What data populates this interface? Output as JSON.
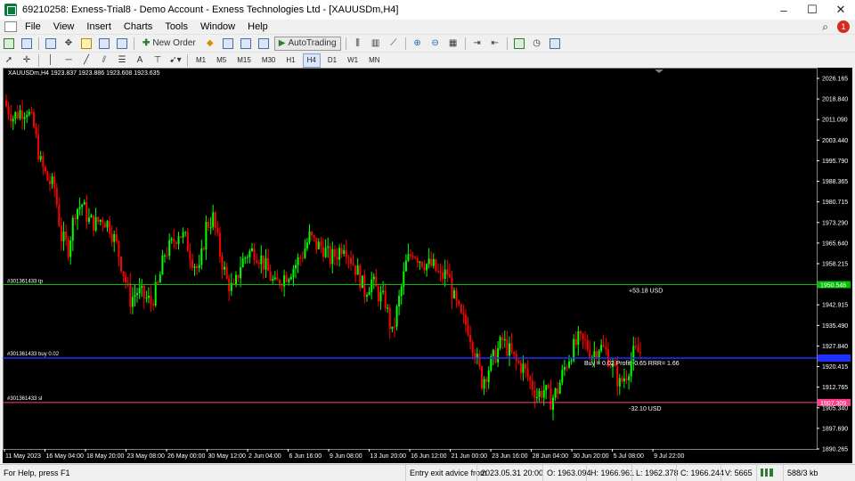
{
  "window": {
    "title": "69210258: Exness-Trial8 - Demo Account - Exness Technologies Ltd - [XAUUSDm,H4]",
    "controls": [
      "–",
      "☐",
      "✕"
    ]
  },
  "menu": {
    "items": [
      "File",
      "View",
      "Insert",
      "Charts",
      "Tools",
      "Window",
      "Help"
    ],
    "notification_count": "1"
  },
  "toolbar": {
    "new_order_label": "New Order",
    "autotrading_label": "AutoTrading",
    "timeframes": [
      "M1",
      "M5",
      "M15",
      "M30",
      "H1",
      "H4",
      "D1",
      "W1",
      "MN"
    ],
    "active_timeframe": "H4",
    "text_tool": "A"
  },
  "chart": {
    "header": "XAUUSDm,H4  1923.837 1923.886 1923.608 1923.635",
    "colors": {
      "bull": "#00ff00",
      "bear": "#ff0000",
      "tp": "#00c000",
      "entry": "#2030ff",
      "sl": "#ff3d8a",
      "info": "#ffd500"
    },
    "objects": {
      "tp_label": "#301361433 tp",
      "buy_label": "#301361433 buy 0.02",
      "sl_label": "#301361433 sl",
      "tp_profit": "+53.18 USD",
      "sl_loss": "-32.10 USD",
      "trade_info": "Buy = 0.02 Profit -0.65   RRR= 1.66",
      "tp_price": "1950.546",
      "sl_price": "1907.309"
    },
    "y_ticks": [
      "2026.165",
      "2018.840",
      "2011.090",
      "2003.440",
      "1995.790",
      "1988.365",
      "1980.715",
      "1973.290",
      "1965.640",
      "1958.215",
      "1950.565",
      "1942.915",
      "1935.490",
      "1927.840",
      "1920.415",
      "1912.765",
      "1905.340",
      "1897.690",
      "1890.265"
    ],
    "x_ticks": [
      "11 May 2023",
      "16 May 04:00",
      "18 May 20:00",
      "23 May 08:00",
      "26 May 00:00",
      "30 May 12:00",
      "2 Jun 04:00",
      "6 Jun 16:00",
      "9 Jun 08:00",
      "13 Jun 20:00",
      "16 Jun 12:00",
      "21 Jun 00:00",
      "23 Jun 16:00",
      "28 Jun 04:00",
      "30 Jun 20:00",
      "5 Jul 08:00",
      "9 Jul 22:00"
    ]
  },
  "chart_data": {
    "type": "candlestick",
    "symbol": "XAUUSDm",
    "timeframe": "H4",
    "ylim": [
      1890.265,
      2026.165
    ],
    "levels": {
      "take_profit": 1950.546,
      "entry": 1923.6,
      "stop_loss": 1907.309
    },
    "close_path": [
      [
        0,
        2016
      ],
      [
        3,
        2012
      ],
      [
        6,
        2014
      ],
      [
        9,
        2015
      ],
      [
        12,
        2008
      ],
      [
        15,
        1995
      ],
      [
        18,
        1989
      ],
      [
        21,
        1986
      ],
      [
        24,
        1968
      ],
      [
        27,
        1964
      ],
      [
        30,
        1978
      ],
      [
        33,
        1980
      ],
      [
        36,
        1974
      ],
      [
        39,
        1973
      ],
      [
        42,
        1975
      ],
      [
        45,
        1972
      ],
      [
        48,
        1965
      ],
      [
        51,
        1955
      ],
      [
        54,
        1945
      ],
      [
        57,
        1948
      ],
      [
        60,
        1946
      ],
      [
        63,
        1944
      ],
      [
        66,
        1950
      ],
      [
        69,
        1962
      ],
      [
        72,
        1965
      ],
      [
        75,
        1970
      ],
      [
        78,
        1967
      ],
      [
        81,
        1960
      ],
      [
        84,
        1955
      ],
      [
        87,
        1972
      ],
      [
        90,
        1975
      ],
      [
        93,
        1962
      ],
      [
        96,
        1952
      ],
      [
        99,
        1948
      ],
      [
        102,
        1958
      ],
      [
        105,
        1962
      ],
      [
        108,
        1963
      ],
      [
        111,
        1960
      ],
      [
        114,
        1955
      ],
      [
        117,
        1950
      ],
      [
        120,
        1953
      ],
      [
        123,
        1955
      ],
      [
        126,
        1958
      ],
      [
        129,
        1962
      ],
      [
        132,
        1968
      ],
      [
        135,
        1965
      ],
      [
        138,
        1964
      ],
      [
        141,
        1960
      ],
      [
        144,
        1962
      ],
      [
        147,
        1966
      ],
      [
        150,
        1960
      ],
      [
        153,
        1955
      ],
      [
        156,
        1948
      ],
      [
        159,
        1952
      ],
      [
        162,
        1947
      ],
      [
        165,
        1944
      ],
      [
        168,
        1932
      ],
      [
        171,
        1945
      ],
      [
        174,
        1958
      ],
      [
        177,
        1963
      ],
      [
        180,
        1960
      ],
      [
        183,
        1958
      ],
      [
        186,
        1957
      ],
      [
        189,
        1953
      ],
      [
        192,
        1955
      ],
      [
        195,
        1945
      ],
      [
        198,
        1938
      ],
      [
        201,
        1935
      ],
      [
        204,
        1926
      ],
      [
        207,
        1915
      ],
      [
        210,
        1920
      ],
      [
        213,
        1925
      ],
      [
        216,
        1930
      ],
      [
        219,
        1926
      ],
      [
        222,
        1922
      ],
      [
        225,
        1920
      ],
      [
        228,
        1915
      ],
      [
        231,
        1910
      ],
      [
        234,
        1912
      ],
      [
        237,
        1908
      ],
      [
        240,
        1912
      ],
      [
        243,
        1920
      ],
      [
        246,
        1926
      ],
      [
        249,
        1930
      ],
      [
        252,
        1929
      ],
      [
        255,
        1925
      ],
      [
        258,
        1928
      ],
      [
        261,
        1926
      ],
      [
        264,
        1920
      ],
      [
        267,
        1914
      ],
      [
        270,
        1918
      ],
      [
        273,
        1925
      ],
      [
        276,
        1926
      ]
    ]
  },
  "statusbar": {
    "help": "For Help, press F1",
    "profile": "Entry exit advice from",
    "datetime": "2023.05.31 20:00",
    "open": "O: 1963.094",
    "high": "H: 1966.961",
    "low": "L: 1962.378",
    "close": "C: 1966.244",
    "volume": "V: 5665",
    "traffic": "588/3 kb"
  }
}
